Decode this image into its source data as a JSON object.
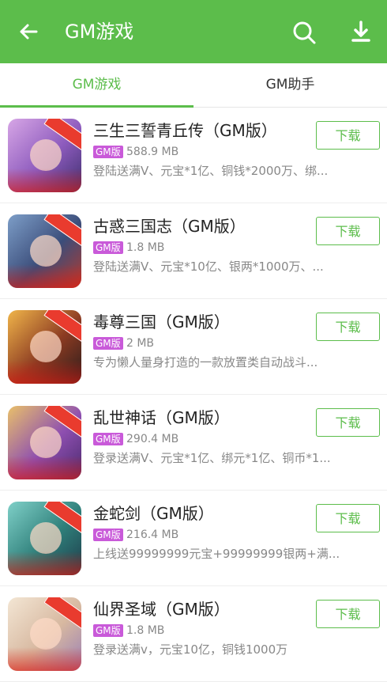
{
  "header": {
    "title": "GM游戏"
  },
  "tabs": [
    {
      "label": "GM游戏"
    },
    {
      "label": "GM助手"
    }
  ],
  "colors": {
    "brand": "#5cbd4b",
    "badge": "#c95ad9"
  },
  "icons": {
    "back": "arrow-left-icon",
    "search": "search-icon",
    "download": "download-icon"
  },
  "items": [
    {
      "name": "三生三誓青丘传（GM版）",
      "badge": "GM版",
      "size": "588.9 MB",
      "desc": "登陆送满V、元宝*1亿、铜钱*2000万、绑...",
      "button": "下载"
    },
    {
      "name": "古惑三国志（GM版）",
      "badge": "GM版",
      "size": "1.8 MB",
      "desc": "登陆送满V、元宝*10亿、银两*1000万、...",
      "button": "下载"
    },
    {
      "name": "毒尊三国（GM版）",
      "badge": "GM版",
      "size": "2 MB",
      "desc": "专为懒人量身打造的一款放置类自动战斗...",
      "button": "下载"
    },
    {
      "name": "乱世神话（GM版）",
      "badge": "GM版",
      "size": "290.4 MB",
      "desc": "登录送满V、元宝*1亿、绑元*1亿、铜币*1...",
      "button": "下载"
    },
    {
      "name": "金蛇剑（GM版）",
      "badge": "GM版",
      "size": "216.4 MB",
      "desc": "上线送99999999元宝+99999999银两+满...",
      "button": "下载"
    },
    {
      "name": "仙界圣域（GM版）",
      "badge": "GM版",
      "size": "1.8 MB",
      "desc": "登录送满v，元宝10亿，铜钱1000万",
      "button": "下载"
    }
  ]
}
